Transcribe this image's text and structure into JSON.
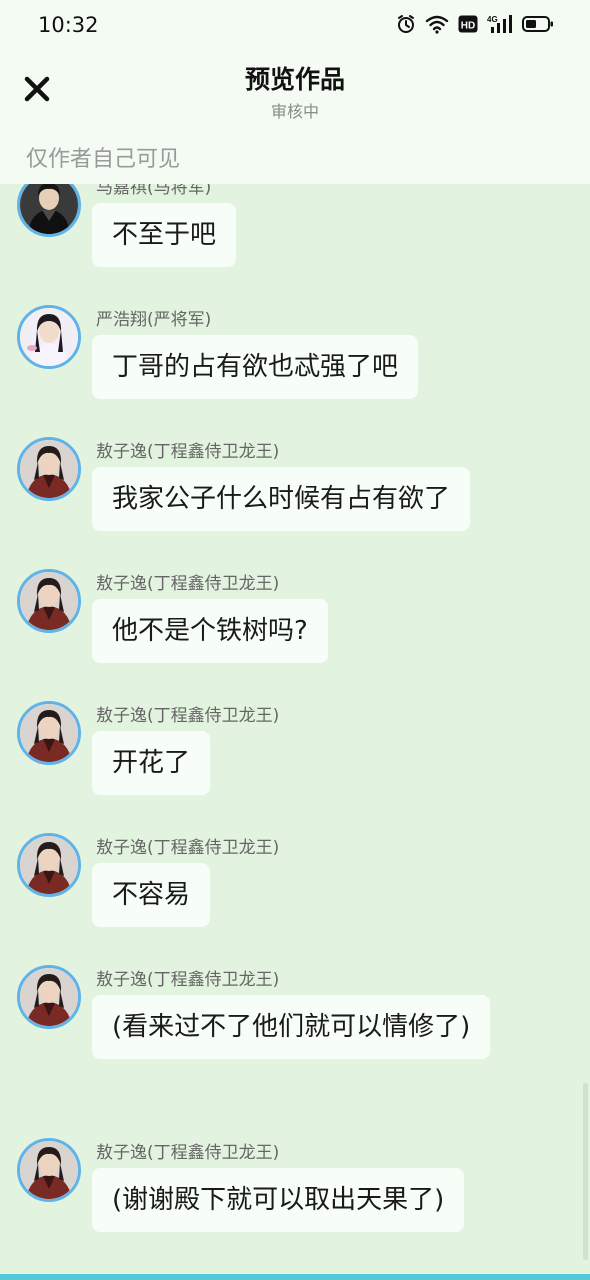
{
  "status_bar": {
    "time": "10:32",
    "icons": [
      "alarm-icon",
      "wifi-icon",
      "hd-icon",
      "signal-4g-icon",
      "battery-icon"
    ],
    "network_label": "4G",
    "hd_label": "HD"
  },
  "header": {
    "title": "预览作品",
    "subtitle": "审核中",
    "close_icon": "close-icon",
    "visibility_note": "仅作者自己可见"
  },
  "messages": [
    {
      "sender": "马嘉祺(马将军)",
      "text": "不至于吧",
      "avatar": "avatar-dark-robe"
    },
    {
      "sender": "严浩翔(严将军)",
      "text": "丁哥的占有欲也忒强了吧",
      "avatar": "avatar-light-pink"
    },
    {
      "sender": "敖子逸(丁程鑫侍卫龙王)",
      "text": "我家公子什么时候有占有欲了",
      "avatar": "avatar-red-robe"
    },
    {
      "sender": "敖子逸(丁程鑫侍卫龙王)",
      "text": "他不是个铁树吗?",
      "avatar": "avatar-red-robe"
    },
    {
      "sender": "敖子逸(丁程鑫侍卫龙王)",
      "text": "开花了",
      "avatar": "avatar-red-robe"
    },
    {
      "sender": "敖子逸(丁程鑫侍卫龙王)",
      "text": "不容易",
      "avatar": "avatar-red-robe"
    },
    {
      "sender": "敖子逸(丁程鑫侍卫龙王)",
      "text": "(看来过不了他们就可以情修了)",
      "avatar": "avatar-red-robe"
    },
    {
      "sender": "敖子逸(丁程鑫侍卫龙王)",
      "text": "(谢谢殿下就可以取出天果了)",
      "avatar": "avatar-red-robe"
    }
  ],
  "colors": {
    "chat_background": "#e2f3df",
    "header_background": "#f3fbf3",
    "bubble_background": "#f7fdf7",
    "avatar_border": "#5fb3e8",
    "bottom_strip": "#54c8d8"
  }
}
